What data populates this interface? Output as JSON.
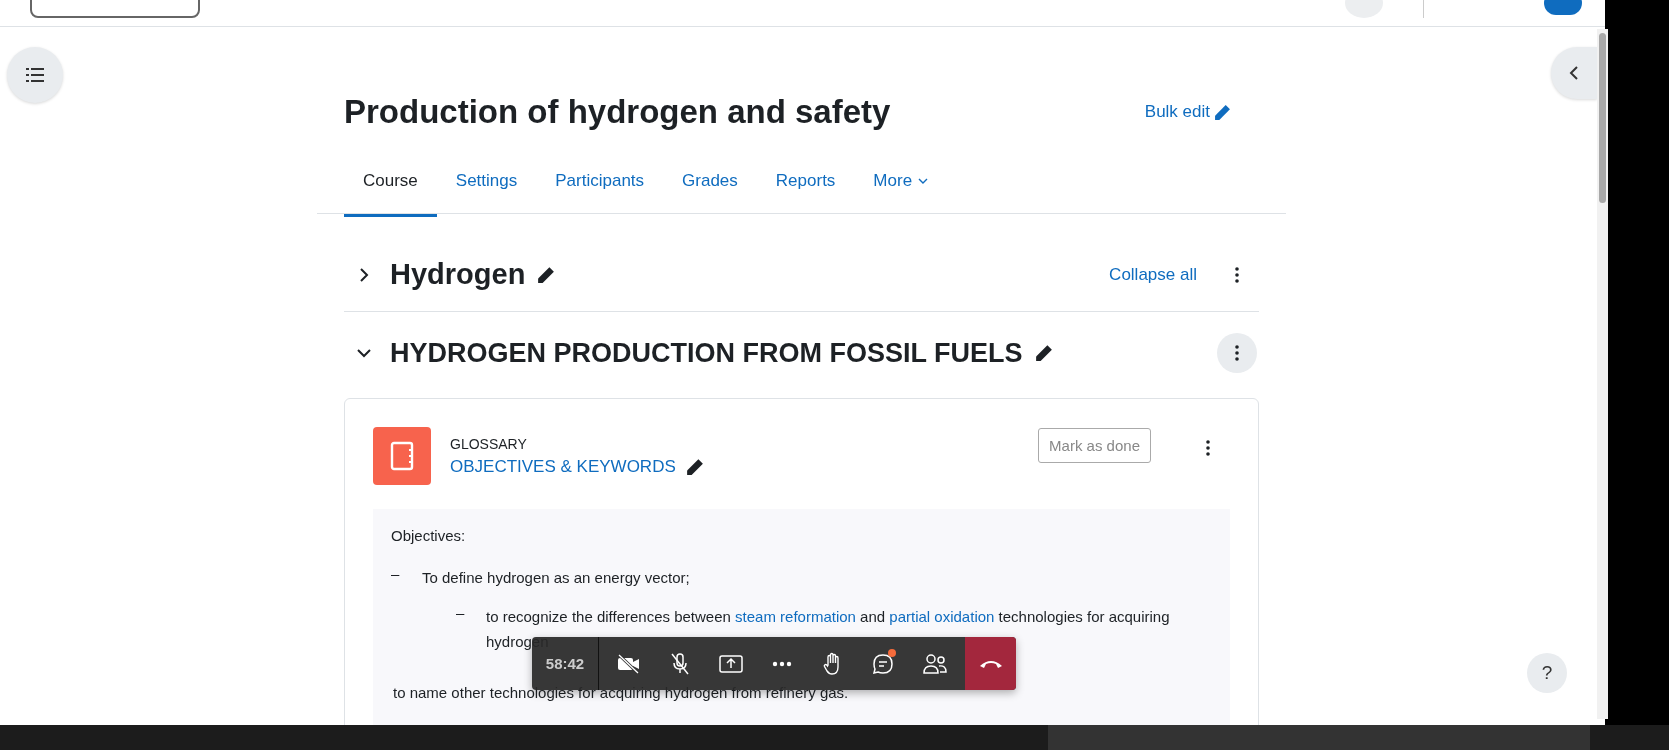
{
  "header": {
    "edit_mode": true
  },
  "course": {
    "title": "Production of hydrogen and safety",
    "bulk_edit": "Bulk edit"
  },
  "tabs": [
    {
      "label": "Course",
      "selected": true,
      "kind": "tab"
    },
    {
      "label": "Settings",
      "selected": false,
      "kind": "tab"
    },
    {
      "label": "Participants",
      "selected": false,
      "kind": "tab"
    },
    {
      "label": "Grades",
      "selected": false,
      "kind": "tab"
    },
    {
      "label": "Reports",
      "selected": false,
      "kind": "tab"
    },
    {
      "label": "More",
      "selected": false,
      "kind": "dropdown"
    }
  ],
  "sections": [
    {
      "title": "Hydrogen",
      "expanded": false,
      "action": "Collapse all"
    },
    {
      "title": "HYDROGEN PRODUCTION FROM FOSSIL FUELS",
      "expanded": true
    }
  ],
  "activity": {
    "type": "GLOSSARY",
    "name": "OBJECTIVES & KEYWORDS",
    "button": "Mark as done",
    "content": [
      {
        "kind": "heading",
        "parts": [
          {
            "kind": "text",
            "text": "Objectives:"
          }
        ]
      },
      {
        "kind": "bullet",
        "marker": "–",
        "parts": [
          {
            "kind": "text",
            "text": "To define hydrogen as an energy vector;"
          }
        ]
      },
      {
        "kind": "subbullet",
        "marker": "–",
        "parts": [
          {
            "kind": "text",
            "text": "to recognize the differences between "
          },
          {
            "kind": "link",
            "text": "steam reformation"
          },
          {
            "kind": "text",
            "text": " and "
          },
          {
            "kind": "link",
            "text": "partial oxidation"
          },
          {
            "kind": "text",
            "text": " technologies for acquiring hydrogen"
          }
        ]
      },
      {
        "kind": "plain",
        "parts": [
          {
            "kind": "text",
            "text": "to name other technologies for acquiring hydrogen from refinery gas."
          }
        ]
      }
    ]
  },
  "call_toolbar": {
    "timer": "58:42",
    "camera_on": false,
    "mic_on": false,
    "chat_unread": true
  },
  "help": "?"
}
